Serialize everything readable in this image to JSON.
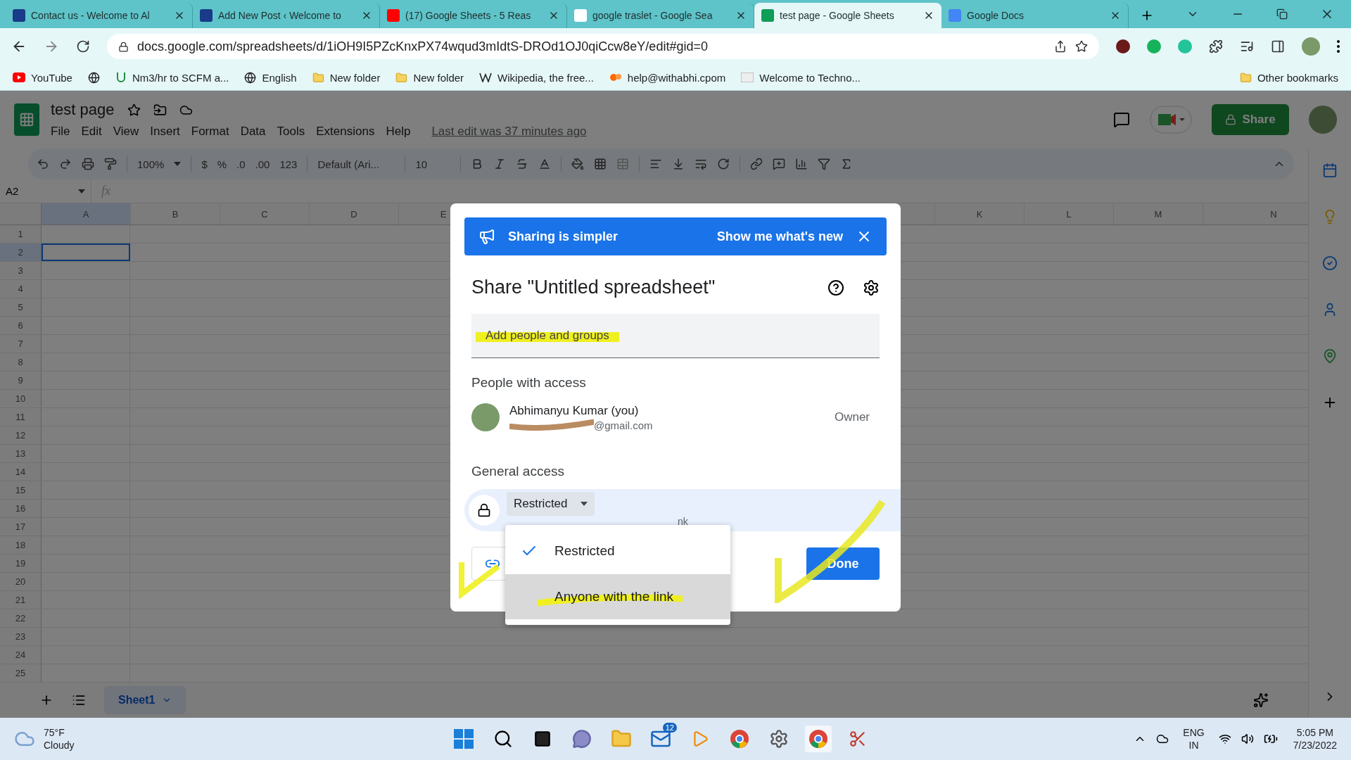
{
  "browser": {
    "tabs": [
      {
        "kind": "site",
        "title": "Contact us - Welcome to Al",
        "selected": false
      },
      {
        "kind": "site",
        "title": "Add New Post ‹ Welcome to",
        "selected": false
      },
      {
        "kind": "video",
        "title": "(17) Google Sheets - 5 Reas",
        "selected": false
      },
      {
        "kind": "search",
        "title": "google traslet - Google Sea",
        "selected": false
      },
      {
        "kind": "sheets",
        "title": "test page - Google Sheets",
        "selected": true
      },
      {
        "kind": "docs",
        "title": "Google Docs",
        "selected": false
      }
    ],
    "url": "docs.google.com/spreadsheets/d/1iOH9I5PZcKnxPX74wqud3mIdtS-DROd1OJ0qiCcw8eY/edit#gid=0",
    "bookmarks": [
      {
        "kind": "video",
        "label": "YouTube"
      },
      {
        "kind": "globe"
      },
      {
        "kind": "page",
        "label": "Nm3/hr to SCFM a..."
      },
      {
        "kind": "globe",
        "label": "English"
      },
      {
        "kind": "folder",
        "label": "New folder"
      },
      {
        "kind": "folder",
        "label": "New folder"
      },
      {
        "kind": "wiki",
        "label": "Wikipedia, the free..."
      },
      {
        "kind": "mail",
        "label": "help@withabhi.cpom"
      },
      {
        "kind": "site",
        "label": "Welcome to Techno..."
      }
    ],
    "other_bookmarks": "Other bookmarks"
  },
  "sheets": {
    "title": "test page",
    "menus": [
      "File",
      "Edit",
      "View",
      "Insert",
      "Format",
      "Data",
      "Tools",
      "Extensions",
      "Help"
    ],
    "last_edit": "Last edit was 37 minutes ago",
    "share": "Share",
    "toolbar": {
      "zoom": "100%",
      "currency": "$",
      "percent": "%",
      "decrease_decimal": ".0",
      "increase_decimal": ".00",
      "more_formats": "123",
      "font": "Default (Ari...",
      "font_size": "10"
    },
    "name_box": "A2",
    "formula_label": "fx",
    "columns_left": [
      {
        "label": "A",
        "selected": true
      },
      {
        "label": "B",
        "selected": false
      },
      {
        "label": "C",
        "selected": false
      },
      {
        "label": "D",
        "selected": false
      },
      {
        "label": "E",
        "selected": false
      }
    ],
    "columns_right": [
      {
        "label": "K",
        "selected": false
      },
      {
        "label": "L",
        "selected": false
      },
      {
        "label": "M",
        "selected": false
      },
      {
        "label": "N",
        "selected": false
      }
    ],
    "rows": [
      {
        "label": "1",
        "selected": false
      },
      {
        "label": "2",
        "selected": true
      },
      {
        "label": "3",
        "selected": false
      },
      {
        "label": "4",
        "selected": false
      },
      {
        "label": "5",
        "selected": false
      },
      {
        "label": "6",
        "selected": false
      },
      {
        "label": "7",
        "selected": false
      },
      {
        "label": "8",
        "selected": false
      },
      {
        "label": "9",
        "selected": false
      },
      {
        "label": "10",
        "selected": false
      },
      {
        "label": "11",
        "selected": false
      },
      {
        "label": "12",
        "selected": false
      },
      {
        "label": "13",
        "selected": false
      },
      {
        "label": "14",
        "selected": false
      },
      {
        "label": "15",
        "selected": false
      },
      {
        "label": "16",
        "selected": false
      },
      {
        "label": "17",
        "selected": false
      },
      {
        "label": "18",
        "selected": false
      },
      {
        "label": "19",
        "selected": false
      },
      {
        "label": "20",
        "selected": false
      },
      {
        "label": "21",
        "selected": false
      },
      {
        "label": "22",
        "selected": false
      },
      {
        "label": "23",
        "selected": false
      },
      {
        "label": "24",
        "selected": false
      },
      {
        "label": "25",
        "selected": false
      }
    ],
    "sheet_tab": "Sheet1"
  },
  "dialog": {
    "banner": {
      "text": "Sharing is simpler",
      "action": "Show me what's new"
    },
    "title": "Share \"Untitled spreadsheet\"",
    "add_people": {
      "placeholder": "Add people and groups"
    },
    "people_heading": "People with access",
    "people": [
      {
        "name": "Abhimanyu Kumar (you)",
        "email": "@gmail.com",
        "role": "Owner"
      }
    ],
    "general_heading": "General access",
    "access": {
      "value": "Restricted",
      "description": "nk"
    },
    "menu": [
      {
        "label": "Restricted",
        "selected": true,
        "highlighted": false
      },
      {
        "label": "Anyone with the link",
        "selected": false,
        "highlighted": true
      }
    ],
    "done": "Done"
  },
  "taskbar": {
    "temperature": "75°F",
    "weather": "Cloudy",
    "mail_badge": "12",
    "language": "ENG",
    "region": "IN",
    "time": "5:05 PM",
    "date": "7/23/2022"
  }
}
